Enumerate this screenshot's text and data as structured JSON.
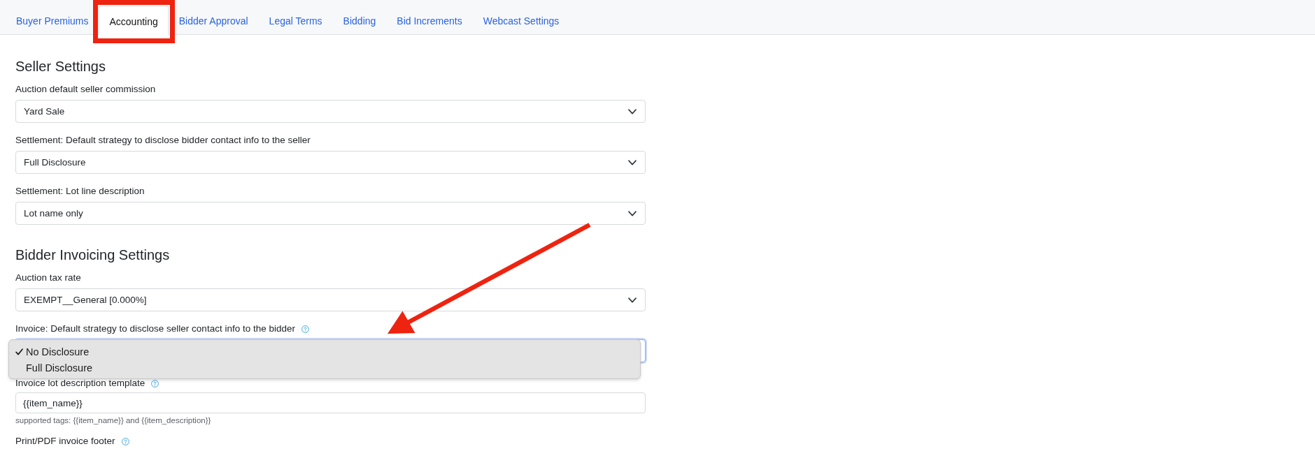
{
  "tabs": [
    {
      "label": "Buyer Premiums",
      "selected": false,
      "highlighted": false
    },
    {
      "label": "Accounting",
      "selected": true,
      "highlighted": true
    },
    {
      "label": "Bidder Approval",
      "selected": false,
      "highlighted": false
    },
    {
      "label": "Legal Terms",
      "selected": false,
      "highlighted": false
    },
    {
      "label": "Bidding",
      "selected": false,
      "highlighted": false
    },
    {
      "label": "Bid Increments",
      "selected": false,
      "highlighted": false
    },
    {
      "label": "Webcast Settings",
      "selected": false,
      "highlighted": false
    }
  ],
  "sections": [
    {
      "title": "Seller Settings",
      "fields": [
        {
          "kind": "select",
          "label": "Auction default seller commission",
          "help": false,
          "expanded": false,
          "value": "Yard Sale"
        },
        {
          "kind": "select",
          "label": "Settlement: Default strategy to disclose bidder contact info to the seller",
          "help": false,
          "expanded": false,
          "value": "Full Disclosure"
        },
        {
          "kind": "select",
          "label": "Settlement: Lot line description",
          "help": false,
          "expanded": false,
          "value": "Lot name only"
        }
      ]
    },
    {
      "title": "Bidder Invoicing Settings",
      "fields": [
        {
          "kind": "select",
          "label": "Auction tax rate",
          "help": false,
          "expanded": false,
          "value": "EXEMPT__General [0.000%]"
        },
        {
          "kind": "select",
          "label": "Invoice: Default strategy to disclose seller contact info to the bidder",
          "help": true,
          "expanded": true,
          "options": [
            {
              "label": "No Disclosure",
              "selected": true
            },
            {
              "label": "Full Disclosure",
              "selected": false
            }
          ]
        },
        {
          "kind": "text",
          "label": "Invoice lot description template",
          "help": true,
          "value": "{{item_name}}",
          "hint": "supported tags: {{item_name}} and {{item_description}}"
        },
        {
          "kind": "label_only",
          "label": "Print/PDF invoice footer",
          "help": true
        }
      ]
    }
  ],
  "annotations": [
    {
      "kind": "arrow"
    }
  ]
}
